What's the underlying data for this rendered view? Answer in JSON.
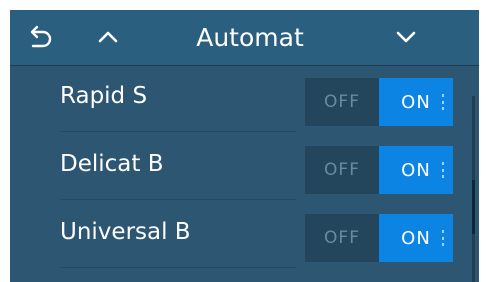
{
  "header": {
    "title": "Automat",
    "back_icon": "back-arrow-icon",
    "up_icon": "chevron-up-icon",
    "down_icon": "chevron-down-icon"
  },
  "programs": [
    {
      "name": "Rapid S",
      "off_label": "OFF",
      "on_label": "ON",
      "state": "on"
    },
    {
      "name": "Delicat B",
      "off_label": "OFF",
      "on_label": "ON",
      "state": "on"
    },
    {
      "name": "Universal B",
      "off_label": "OFF",
      "on_label": "ON",
      "state": "on"
    }
  ],
  "colors": {
    "background": "#2c5672",
    "header": "#2b5f7f",
    "toggle_on": "#0b84e3",
    "toggle_off": "#24465c"
  }
}
